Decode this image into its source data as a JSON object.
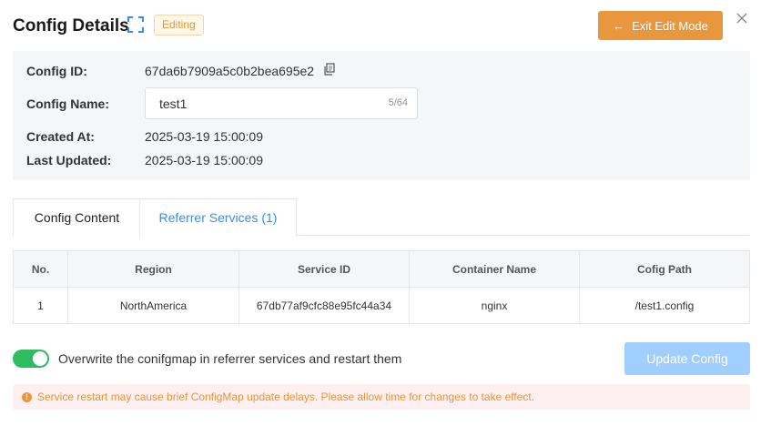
{
  "header": {
    "title": "Config Details",
    "badge": "Editing",
    "exit_button": "Exit Edit Mode",
    "exit_icon": "arrow-left-icon",
    "expand_icon": "expand-icon",
    "close_icon": "close-icon"
  },
  "info": {
    "id_label": "Config ID:",
    "id_value": "67da6b7909a5c0b2bea695e2",
    "name_label": "Config Name:",
    "name_value": "test1",
    "name_count": "5/64",
    "created_label": "Created At:",
    "created_value": "2025-03-19 15:00:09",
    "updated_label": "Last Updated:",
    "updated_value": "2025-03-19 15:00:09"
  },
  "tabs": [
    {
      "label": "Config Content",
      "active": false
    },
    {
      "label": "Referrer Services (1)",
      "active": true
    }
  ],
  "table": {
    "columns": [
      "No.",
      "Region",
      "Service ID",
      "Container Name",
      "Cofig Path"
    ],
    "rows": [
      [
        "1",
        "NorthAmerica",
        "67db77af9cfc88e95fc44a34",
        "nginx",
        "/test1.config"
      ]
    ]
  },
  "footer": {
    "toggle_on": true,
    "toggle_label": "Overwrite the conifgmap in referrer services and restart them",
    "update_button": "Update Config",
    "warning": "Service restart may cause brief ConfigMap update delays. Please allow time for changes to take effect."
  },
  "colors": {
    "accent_orange": "#e8973f",
    "link_blue": "#3a8ee6",
    "toggle_green": "#2fbb5f",
    "disabled_blue": "#a0cfff"
  }
}
